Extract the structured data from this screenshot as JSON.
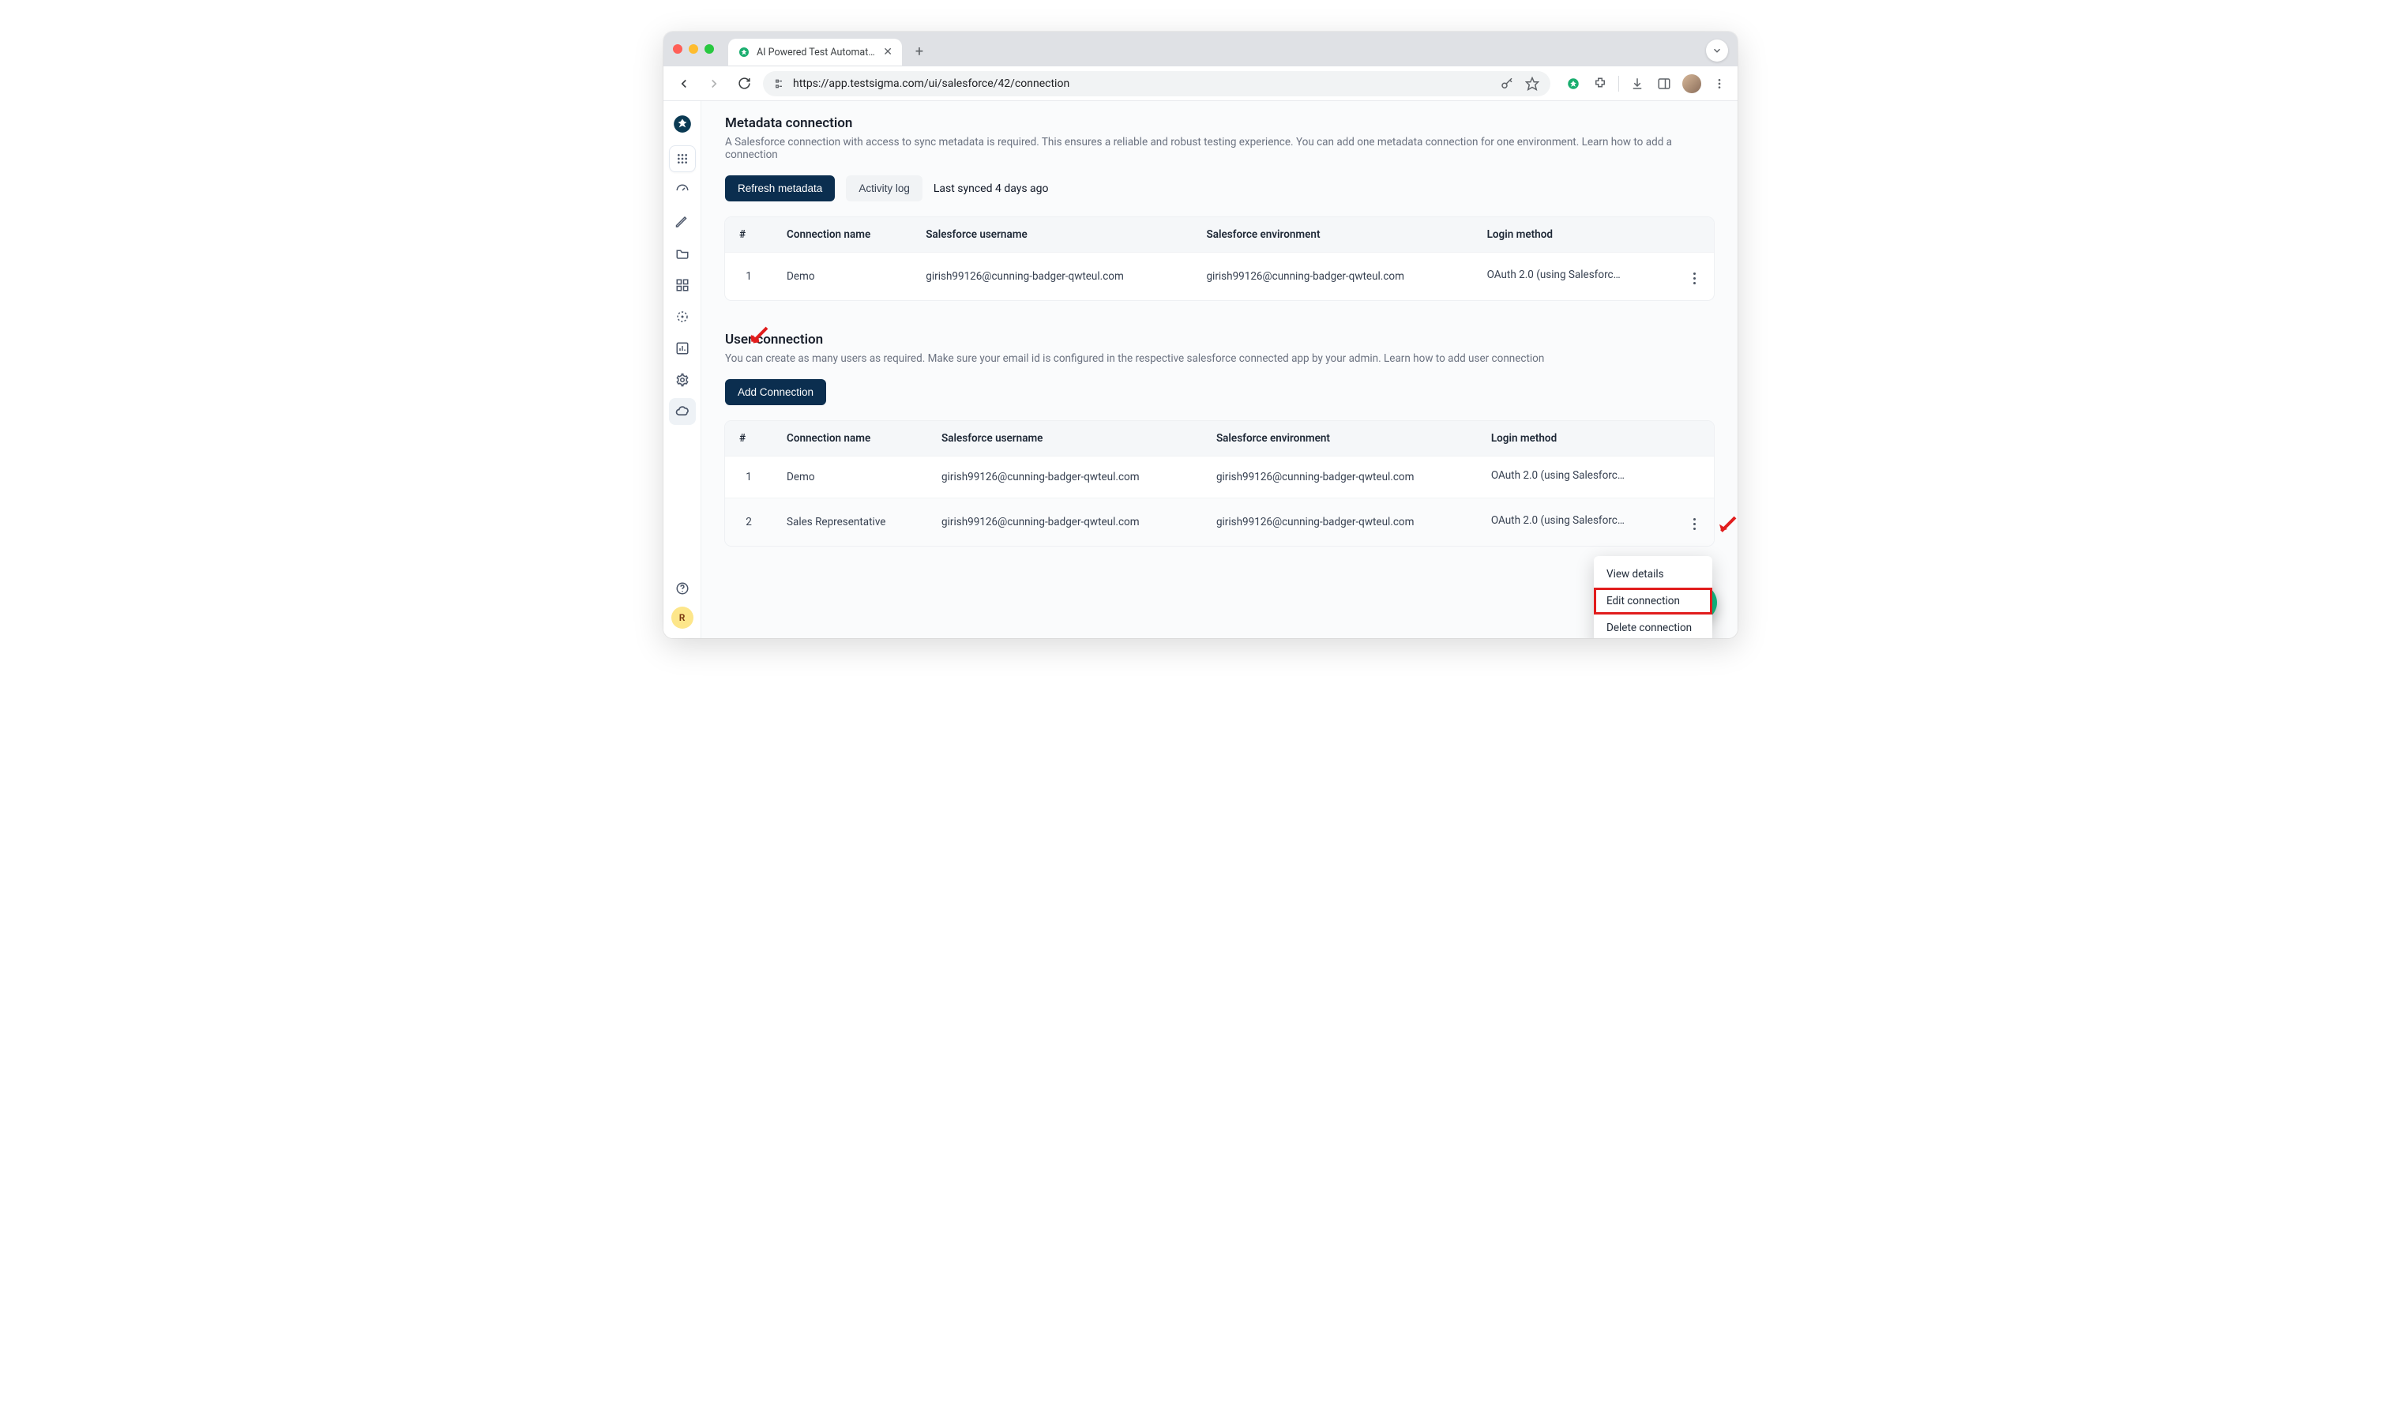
{
  "browser": {
    "tab_title": "AI Powered Test Automation P",
    "url": "https://app.testsigma.com/ui/salesforce/42/connection"
  },
  "sidebar": {
    "avatar_letter": "R"
  },
  "metadata": {
    "title": "Metadata connection",
    "description": "A Salesforce connection with access to sync metadata is required. This ensures a reliable and robust testing experience. You can add one metadata connection for one environment. Learn how to add a connection",
    "refresh_label": "Refresh metadata",
    "activity_log_label": "Activity log",
    "last_synced": "Last synced 4 days ago",
    "columns": {
      "num": "#",
      "name": "Connection name",
      "username": "Salesforce username",
      "environment": "Salesforce environment",
      "login": "Login method"
    },
    "rows": [
      {
        "num": "1",
        "name": "Demo",
        "username": "girish99126@cunning-badger-qwteul.com",
        "environment": "girish99126@cunning-badger-qwteul.com",
        "login": "OAuth 2.0 (using Salesforce ..."
      }
    ]
  },
  "user": {
    "title": "User connection",
    "description": "You can create as many users as required. Make sure your email id is configured in the respective salesforce connected app by your admin. Learn how to add user connection",
    "add_label": "Add Connection",
    "columns": {
      "num": "#",
      "name": "Connection name",
      "username": "Salesforce username",
      "environment": "Salesforce environment",
      "login": "Login method"
    },
    "rows": [
      {
        "num": "1",
        "name": "Demo",
        "username": "girish99126@cunning-badger-qwteul.com",
        "environment": "girish99126@cunning-badger-qwteul.com",
        "login": "OAuth 2.0 (using Salesforce ..."
      },
      {
        "num": "2",
        "name": "Sales Representative",
        "username": "girish99126@cunning-badger-qwteul.com",
        "environment": "girish99126@cunning-badger-qwteul.com",
        "login": "OAuth 2.0 (using Salesforce ..."
      }
    ]
  },
  "context_menu": {
    "view_details": "View details",
    "edit_connection": "Edit connection",
    "delete_connection": "Delete connection"
  }
}
